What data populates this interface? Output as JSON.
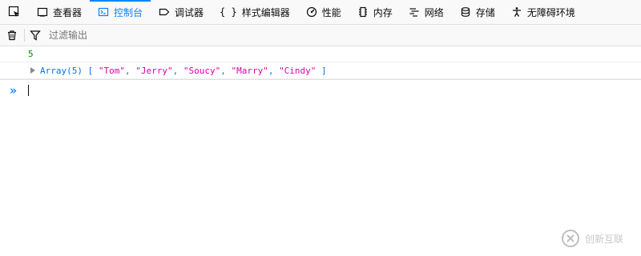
{
  "toolbar": {
    "tabs": [
      {
        "label": "查看器",
        "icon": "inspector-icon"
      },
      {
        "label": "控制台",
        "icon": "console-icon",
        "active": true
      },
      {
        "label": "调试器",
        "icon": "debugger-icon"
      },
      {
        "label": "样式编辑器",
        "icon": "style-editor-icon"
      },
      {
        "label": "性能",
        "icon": "performance-icon"
      },
      {
        "label": "内存",
        "icon": "memory-icon"
      },
      {
        "label": "网络",
        "icon": "network-icon"
      },
      {
        "label": "存储",
        "icon": "storage-icon"
      },
      {
        "label": "无障碍环境",
        "icon": "accessibility-icon"
      }
    ]
  },
  "filterbar": {
    "placeholder": "过滤输出"
  },
  "console": {
    "line1": "5",
    "array": {
      "name": "Array(5)",
      "open": "[",
      "items": [
        "\"Tom\"",
        "\"Jerry\"",
        "\"Soucy\"",
        "\"Marry\"",
        "\"Cindy\""
      ],
      "sep": ", ",
      "close": "]"
    },
    "prompt": "»"
  },
  "watermark": {
    "text": "创新互联"
  },
  "colors": {
    "accent": "#0a84ff",
    "number": "#058b00",
    "string": "#dd00a9",
    "object": "#0074e8"
  }
}
